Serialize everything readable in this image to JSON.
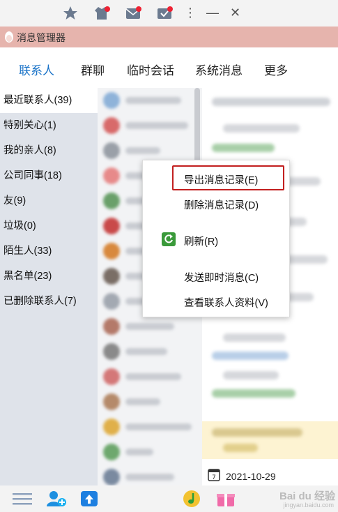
{
  "app": {
    "title": "消息管理器"
  },
  "tabs": [
    {
      "label": "联系人",
      "active": true
    },
    {
      "label": "群聊"
    },
    {
      "label": "临时会话"
    },
    {
      "label": "系统消息"
    },
    {
      "label": "更多"
    }
  ],
  "categories": [
    {
      "label": "最近联系人(39)",
      "selected": true
    },
    {
      "label": "特别关心(1)"
    },
    {
      "label": "我的亲人(8)"
    },
    {
      "label": "公司同事(18)"
    },
    {
      "label": "友(9)"
    },
    {
      "label": "垃圾(0)"
    },
    {
      "label": "陌生人(33)"
    },
    {
      "label": "黑名单(23)"
    },
    {
      "label": "已删除联系人(7)"
    }
  ],
  "context_menu": {
    "items": [
      {
        "label": "导出消息记录(E)",
        "highlighted": true
      },
      {
        "label": "删除消息记录(D)"
      },
      {
        "label": "刷新(R)",
        "icon": "refresh-icon"
      },
      {
        "label": "发送即时消息(C)"
      },
      {
        "label": "查看联系人资料(V)"
      }
    ]
  },
  "date_bar": {
    "date": "2021-10-29"
  },
  "watermark": {
    "text": "Bai du 经验",
    "sub": "jingyan.baidu.com"
  },
  "colors": {
    "accent": "#1a73c8",
    "title_bar": "#e6b4ad",
    "highlight_border": "#c21f1f"
  }
}
